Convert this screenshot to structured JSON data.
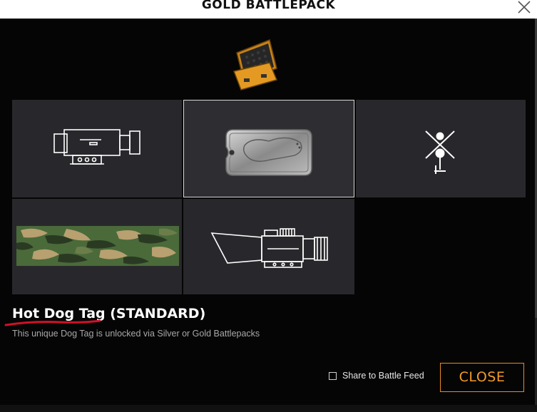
{
  "window": {
    "title": "GOLD BATTLEPACK"
  },
  "icons": {
    "close": "close-x-icon",
    "pack": "briefcase-battlepack-icon",
    "items": [
      "scope-attachment-icon",
      "dog-tag-icon",
      "helicopter-emblem-icon",
      "camo-paint-icon",
      "holo-sight-icon"
    ]
  },
  "grid": {
    "selected_index": 1
  },
  "selected_item": {
    "name": "Hot Dog Tag (STANDARD)",
    "description": "This unique Dog Tag is unlocked via Silver or Gold Battlepacks"
  },
  "footer": {
    "share_label": "Share to Battle Feed",
    "share_checked": false,
    "close_label": "CLOSE"
  },
  "colors": {
    "accent": "#f39a2b",
    "tile": "#28282c",
    "annotation": "#d0102a"
  }
}
